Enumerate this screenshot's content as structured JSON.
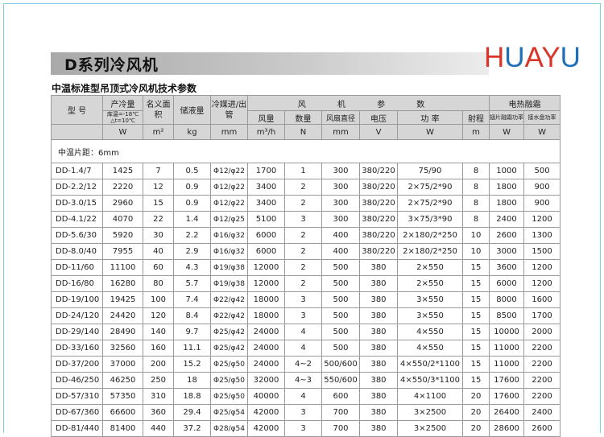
{
  "title": "D系列冷风机",
  "brand": {
    "letters": [
      "H",
      "U",
      "A",
      "Y",
      "U"
    ],
    "colors": {
      "H": "#d9362b",
      "U": "#1d6fb8",
      "A": "#d9362b",
      "Y": "#d9362b",
      "U2": "#1d6fb8"
    }
  },
  "subtitle": "中温标准型吊顶式冷风机技术参数",
  "header": {
    "model": "型 号",
    "capacity": "产冷量",
    "capacity_cond": "库温=-18℃ △t=10℃",
    "area": "名义面积",
    "liquid": "储液量",
    "pipe": "冷媒进/出管",
    "fan_group": "风 机 参 数",
    "defrost_group": "电热融霜",
    "airflow": "风量",
    "qty": "数量",
    "diameter": "风扇直径",
    "voltage": "电压",
    "power": "功 率",
    "range": "射程",
    "fin_power": "翅片融霜功率",
    "tray_power": "接水盘功率"
  },
  "units": {
    "capacity": "W",
    "area": "m²",
    "liquid": "kg",
    "pipe": "mm",
    "airflow": "m³/h",
    "qty": "N",
    "diameter": "mm",
    "voltage": "V",
    "power": "W",
    "range": "m",
    "fin_power": "W",
    "tray_power": "W"
  },
  "fin_pitch": "中温片距：6mm",
  "rows": [
    [
      "DD-1.4/7",
      "1425",
      "7",
      "0.5",
      "Φ12/φ22",
      "1700",
      "1",
      "300",
      "380/220",
      "75/90",
      "8",
      "1000",
      "500"
    ],
    [
      "DD-2.2/12",
      "2220",
      "12",
      "0.9",
      "Φ12/φ22",
      "3400",
      "2",
      "300",
      "380/220",
      "2×75/2*90",
      "8",
      "1800",
      "900"
    ],
    [
      "DD-3.0/15",
      "2960",
      "15",
      "0.9",
      "Φ12/φ22",
      "3400",
      "2",
      "300",
      "380/220",
      "2×75/2*90",
      "8",
      "1800",
      "900"
    ],
    [
      "DD-4.1/22",
      "4070",
      "22",
      "1.4",
      "Φ12/φ25",
      "5100",
      "3",
      "300",
      "380/220",
      "3×75/3*90",
      "8",
      "2400",
      "1200"
    ],
    [
      "DD-5.6/30",
      "5920",
      "30",
      "2.2",
      "Φ16/φ32",
      "6000",
      "2",
      "400",
      "380/220",
      "2×180/2*250",
      "10",
      "2600",
      "1300"
    ],
    [
      "DD-8.0/40",
      "7955",
      "40",
      "2.9",
      "Φ16/φ32",
      "6000",
      "2",
      "400",
      "380/220",
      "2×180/2*250",
      "10",
      "3000",
      "1500"
    ],
    [
      "DD-11/60",
      "11100",
      "60",
      "4.3",
      "Φ19/φ38",
      "12000",
      "2",
      "500",
      "380",
      "2×550",
      "15",
      "3600",
      "1200"
    ],
    [
      "DD-16/80",
      "16280",
      "80",
      "5.7",
      "Φ19/φ38",
      "12000",
      "2",
      "500",
      "380",
      "2×550",
      "15",
      "6000",
      "1200"
    ],
    [
      "DD-19/100",
      "19425",
      "100",
      "7.4",
      "Φ22/φ42",
      "18000",
      "3",
      "500",
      "380",
      "3×550",
      "15",
      "8000",
      "1600"
    ],
    [
      "DD-24/120",
      "24420",
      "120",
      "8.4",
      "Φ22/φ42",
      "18000",
      "3",
      "500",
      "380",
      "3×550",
      "15",
      "8500",
      "1700"
    ],
    [
      "DD-29/140",
      "28490",
      "140",
      "9.7",
      "Φ25/φ42",
      "24000",
      "4",
      "500",
      "380",
      "4×550",
      "15",
      "10000",
      "2000"
    ],
    [
      "DD-33/160",
      "32560",
      "160",
      "11.1",
      "Φ25/φ42",
      "24000",
      "4",
      "500",
      "380",
      "4×550",
      "15",
      "11000",
      "2200"
    ],
    [
      "DD-37/200",
      "37000",
      "200",
      "15.2",
      "Φ25/φ50",
      "24000",
      "4~2",
      "500/600",
      "380",
      "4×550/2*1100",
      "15",
      "11000",
      "2200"
    ],
    [
      "DD-46/250",
      "46250",
      "250",
      "18",
      "Φ25/φ50",
      "32000",
      "4~3",
      "550/600",
      "380",
      "4×550/3*1100",
      "15",
      "17600",
      "2200"
    ],
    [
      "DD-57/310",
      "57350",
      "310",
      "18.8",
      "Φ25/φ50",
      "40000",
      "4",
      "600",
      "380",
      "4×1100",
      "20",
      "17600",
      "2200"
    ],
    [
      "DD-67/360",
      "66600",
      "360",
      "29.4",
      "Φ25/φ54",
      "42000",
      "3",
      "700",
      "380",
      "3×2500",
      "20",
      "26400",
      "2400"
    ],
    [
      "DD-81/440",
      "81400",
      "440",
      "37.2",
      "Φ28/φ54",
      "42000",
      "3",
      "700",
      "380",
      "3×2500",
      "20",
      "28600",
      "2600"
    ]
  ]
}
